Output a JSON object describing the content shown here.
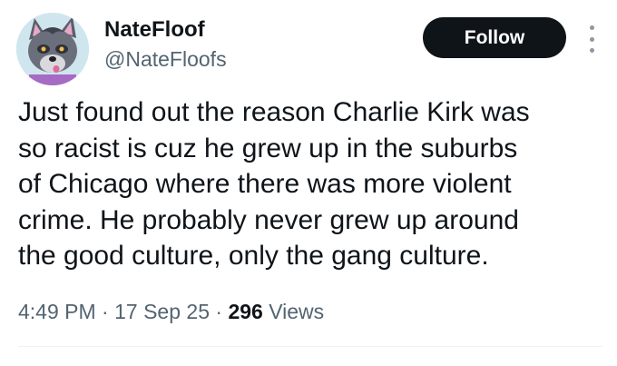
{
  "author": {
    "display_name": "NateFloof",
    "handle": "@NateFloofs"
  },
  "actions": {
    "follow_label": "Follow",
    "more_icon": "more-vertical-icon"
  },
  "tweet": {
    "text_lines": [
      "Just found out the reason Charlie Kirk was",
      "so racist is cuz he grew up in the suburbs",
      "of Chicago where there was more violent",
      "crime. He probably never grew up around",
      "the good culture, only the gang culture."
    ]
  },
  "meta": {
    "time": "4:49 PM",
    "separator": "·",
    "date": "17 Sep 25",
    "views_count": "296",
    "views_label": "Views"
  },
  "colors": {
    "text_primary": "#0f1419",
    "text_secondary": "#536471",
    "follow_bg": "#0f1419",
    "avatar_bg": "#cfe6ee"
  }
}
